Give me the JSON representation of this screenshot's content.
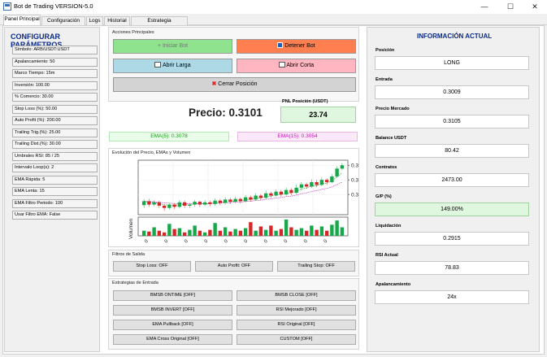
{
  "window": {
    "title": "Bot de Trading VERSION-5.0",
    "minimize": "—",
    "maximize": "☐",
    "close": "✕"
  },
  "tabs": [
    "Panel Principal",
    "Configuración API",
    "Logs",
    "Historial",
    "Estrategia Personalizada"
  ],
  "left": {
    "title": "CONFIGURAR PARÁMETROS",
    "params": [
      "Símbolo: ARB/USDT:USDT",
      "Apalancamiento: 50",
      "Marco Tiempo: 15m",
      "Inversión: 100.00",
      "% Comercio: 30.00",
      "Stop Loss (%): 50.00",
      "Auto Profit (%): 200.00",
      "Trailing Trig.(%): 25.00",
      "Trailing Dist.(%): 30.00",
      "Umbrales RSI: 85 / 25",
      "Intervalo Loop(s): 2",
      "EMA Rápida: 5",
      "EMA Lenta: 15",
      "EMA Filtro Periodo: 100",
      "Usar Filtro EMA: False"
    ]
  },
  "actions": {
    "group_label": "Acciones Principales",
    "start": "Iniciar Bot",
    "stop": "Detener Bot",
    "open_long": "Abrir Larga",
    "open_short": "Abrir Corta",
    "close": "Cerrar Posición"
  },
  "price": {
    "text": "Precio: 0.3101",
    "pnl_label": "PNL Posición (USDT)",
    "pnl_value": "23.74",
    "ema_fast": "EMA(5): 0.3078",
    "ema_slow": "EMA(15): 0.3054"
  },
  "colors": {
    "green": "#17a84a",
    "red": "#d62728",
    "start": "#8fe38f",
    "stop": "#ff7f50",
    "long": "#add8e6",
    "short": "#ffb6c1",
    "ema_fast": "#1a9c1a",
    "ema_slow": "#c013b3",
    "title_blue": "#0b2a8a"
  },
  "chart": {
    "title": "Evolución del Precio, EMAs y Volumen",
    "ytick": "0.3",
    "volume_label": "Volumen",
    "xtick": "0"
  },
  "chart_data": {
    "type": "candlestick",
    "title": "Evolución del Precio, EMAs y Volumen",
    "ylabel_volume": "Volumen",
    "ytick_labels": [
      "0.3",
      "0.3",
      "0.3"
    ],
    "candles": [
      [
        0.2995,
        0.3002,
        0.299,
        0.3006,
        1
      ],
      [
        0.3002,
        0.2996,
        0.2992,
        0.3006,
        0
      ],
      [
        0.2996,
        0.3,
        0.2993,
        0.3004,
        1
      ],
      [
        0.3,
        0.2994,
        0.299,
        0.3003,
        0
      ],
      [
        0.2994,
        0.299,
        0.2985,
        0.2997,
        0
      ],
      [
        0.299,
        0.2996,
        0.2987,
        0.2999,
        1
      ],
      [
        0.2996,
        0.2992,
        0.2988,
        0.2999,
        0
      ],
      [
        0.2992,
        0.3,
        0.2989,
        0.3004,
        1
      ],
      [
        0.3,
        0.2994,
        0.299,
        0.3003,
        0
      ],
      [
        0.2994,
        0.2996,
        0.299,
        0.2999,
        1
      ],
      [
        0.2996,
        0.3001,
        0.2992,
        0.3004,
        1
      ],
      [
        0.3001,
        0.2996,
        0.2992,
        0.3003,
        0
      ],
      [
        0.2996,
        0.3,
        0.2993,
        0.3004,
        1
      ],
      [
        0.3,
        0.2997,
        0.2993,
        0.3003,
        0
      ],
      [
        0.2997,
        0.3003,
        0.2994,
        0.3007,
        1
      ],
      [
        0.3003,
        0.2999,
        0.2995,
        0.3006,
        0
      ],
      [
        0.2999,
        0.3005,
        0.2996,
        0.3009,
        1
      ],
      [
        0.3005,
        0.3001,
        0.2997,
        0.3008,
        0
      ],
      [
        0.3001,
        0.3006,
        0.2998,
        0.301,
        1
      ],
      [
        0.3006,
        0.3002,
        0.2998,
        0.3009,
        0
      ],
      [
        0.3002,
        0.3009,
        0.3,
        0.3013,
        1
      ],
      [
        0.3009,
        0.3005,
        0.3001,
        0.3012,
        0
      ],
      [
        0.3005,
        0.3012,
        0.3003,
        0.3016,
        1
      ],
      [
        0.3012,
        0.3008,
        0.3004,
        0.3015,
        0
      ],
      [
        0.3008,
        0.3016,
        0.3006,
        0.3021,
        1
      ],
      [
        0.3016,
        0.3012,
        0.3008,
        0.3019,
        0
      ],
      [
        0.3012,
        0.3019,
        0.301,
        0.3023,
        1
      ],
      [
        0.3019,
        0.3014,
        0.301,
        0.3022,
        0
      ],
      [
        0.3014,
        0.3022,
        0.3012,
        0.3026,
        1
      ],
      [
        0.3022,
        0.3017,
        0.3013,
        0.3025,
        0
      ],
      [
        0.3017,
        0.3026,
        0.3015,
        0.3032,
        1
      ],
      [
        0.3026,
        0.3032,
        0.3021,
        0.3036,
        1
      ],
      [
        0.3032,
        0.3028,
        0.3024,
        0.3035,
        0
      ],
      [
        0.3028,
        0.3036,
        0.3026,
        0.3041,
        1
      ],
      [
        0.3036,
        0.3031,
        0.3027,
        0.304,
        0
      ],
      [
        0.3031,
        0.304,
        0.3029,
        0.3045,
        1
      ],
      [
        0.304,
        0.3036,
        0.3031,
        0.3043,
        0
      ],
      [
        0.3036,
        0.3046,
        0.3034,
        0.305,
        1
      ],
      [
        0.3046,
        0.306,
        0.3044,
        0.3064,
        1
      ],
      [
        0.306,
        0.3066,
        0.3057,
        0.307,
        1
      ]
    ],
    "volumes": [
      0.3,
      0.25,
      0.5,
      0.3,
      0.2,
      0.7,
      0.4,
      0.45,
      0.2,
      0.35,
      0.6,
      0.3,
      0.2,
      0.35,
      0.75,
      0.3,
      0.5,
      0.25,
      0.4,
      0.3,
      0.45,
      0.8,
      0.3,
      0.55,
      0.35,
      0.6,
      0.3,
      0.4,
      0.95,
      0.5,
      0.35,
      0.45,
      0.3,
      0.6,
      0.35,
      0.55,
      0.3,
      0.65,
      0.9,
      0.5
    ],
    "series": [
      {
        "name": "EMA(5)",
        "color": "#1a9c1a"
      },
      {
        "name": "EMA(15)",
        "color": "#c013b3"
      }
    ]
  },
  "exit_filters": {
    "label": "Filtros de Salida",
    "stop_loss": "Stop Loss: OFF",
    "auto_profit": "Auto Profit: OFF",
    "trailing_stop": "Trailing Stop: OFF"
  },
  "strategies": {
    "label": "Estrategias de Entrada",
    "items": [
      "BMSB ONTIME [OFF]",
      "BMSB CLOSE [OFF]",
      "BMSB INVERT [OFF]",
      "RSI Mejorado [OFF]",
      "EMA Pullback [OFF]",
      "RSI Original [OFF]",
      "EMA Cross Original [OFF]",
      "CUSTOM [OFF]"
    ]
  },
  "right": {
    "title": "INFORMACIÓN ACTUAL",
    "fields": [
      {
        "label": "Posición",
        "value": "LONG"
      },
      {
        "label": "Entrada",
        "value": "0.3009"
      },
      {
        "label": "Precio Mercado",
        "value": "0.3105"
      },
      {
        "label": "Balance USDT",
        "value": "80.42"
      },
      {
        "label": "Contratos",
        "value": "2473.00"
      },
      {
        "label": "G/P (%)",
        "value": "149.00%"
      },
      {
        "label": "Liquidación",
        "value": "0.2915"
      },
      {
        "label": "RSI Actual",
        "value": "78.83"
      },
      {
        "label": "Apalancamiento",
        "value": "24x"
      }
    ]
  }
}
